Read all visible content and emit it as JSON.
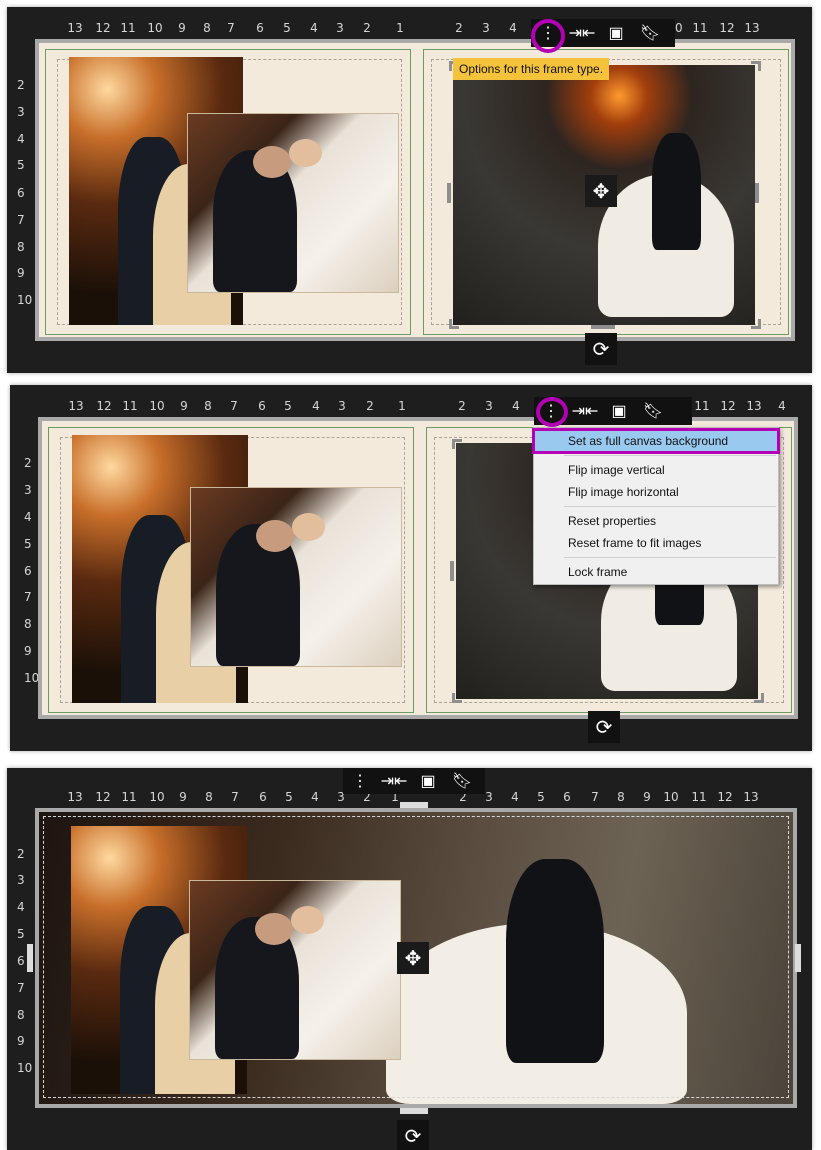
{
  "ruler": {
    "top_labels": [
      "13",
      "12",
      "11",
      "10",
      "9",
      "8",
      "7",
      "6",
      "5",
      "4",
      "3",
      "2",
      "1",
      "2",
      "3",
      "4",
      "5",
      "6",
      "7",
      "8",
      "9",
      "10",
      "11",
      "12",
      "13",
      "4"
    ],
    "side_labels": [
      "2",
      "3",
      "4",
      "5",
      "6",
      "7",
      "8",
      "9",
      "10"
    ]
  },
  "toolbar": {
    "options_icon": "vertical-ellipsis-icon",
    "fit_icon": "compress-arrows-icon",
    "image_icon": "crop-image-icon",
    "bookmark_icon": "bookmark-icon"
  },
  "tooltip": {
    "text": "Options for this frame type."
  },
  "context_menu": {
    "items": [
      "Set as full canvas background",
      "Flip image vertical",
      "Flip image horizontal",
      "Reset properties",
      "Reset frame to fit images",
      "Lock frame"
    ]
  },
  "colors": {
    "highlight": "#b400b4",
    "tooltip": "#f5c33b",
    "menu_selected": "#99c9ef",
    "panel_bg": "#1e1e1e",
    "page": "#f4eadb"
  }
}
